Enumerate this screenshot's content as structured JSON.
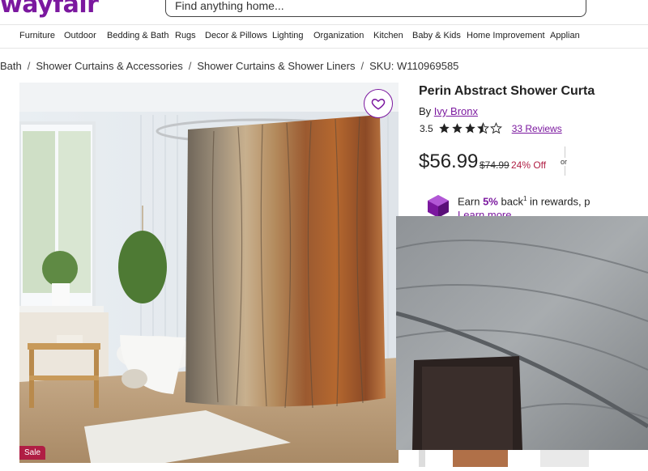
{
  "header": {
    "logo_text": "wayfair",
    "search_placeholder": "Find anything home..."
  },
  "nav": {
    "items": [
      "Furniture",
      "Outdoor",
      "Bedding & Bath",
      "Rugs",
      "Decor & Pillows",
      "Lighting",
      "Organization",
      "Kitchen",
      "Baby & Kids",
      "Home Improvement",
      "Applian"
    ]
  },
  "breadcrumb": [
    "Bath",
    "Shower Curtains & Accessories",
    "Shower Curtains & Shower Liners",
    "SKU: W110969585"
  ],
  "product": {
    "title": "Perin Abstract Shower Curta",
    "by_label": "By",
    "brand": "Ivy Bronx",
    "rating": "3.5",
    "stars_filled": 3.5,
    "reviews": "33 Reviews",
    "price": "$56.99",
    "old_price": "$74.99",
    "discount": "24% Off",
    "or_label": "or",
    "rewards_pre": "Earn ",
    "rewards_pct": "5%",
    "rewards_post": " back",
    "rewards_sup": "1",
    "rewards_tail": " in rewards, p",
    "learn_more": "Learn more",
    "sale_badge": "Sale"
  },
  "colors": {
    "brand": "#7b189f",
    "sale": "#b01e44"
  }
}
